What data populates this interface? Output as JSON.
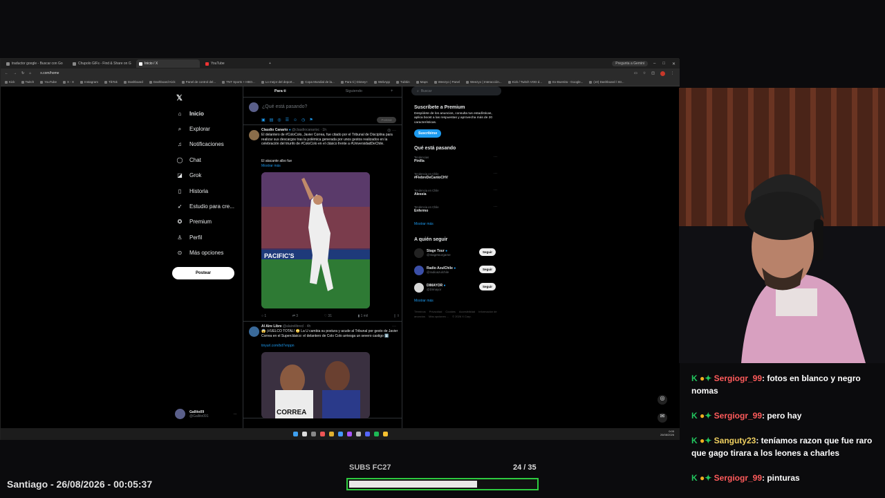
{
  "browser": {
    "tabs": [
      {
        "label": "traductor google - Buscar con Go",
        "active": false
      },
      {
        "label": "Chupolo GIFs - Find & Share on G",
        "active": false
      },
      {
        "label": "Inicio / X",
        "active": true
      },
      {
        "label": "YouTube",
        "active": false
      }
    ],
    "gemini_label": "Pregunta a Gemini",
    "url": "x.com/home",
    "bookmarks": [
      "Kick",
      "Twitch",
      "YouTube",
      "X - X",
      "Instagram",
      "TikTok",
      "Dashboard",
      "Dashboard Kick",
      "Panel de control del...",
      "TNT Sports + HBO...",
      "Lo mejor del deport...",
      "Copa Mundial de la...",
      "Para ti | Disney+",
      "WebApp",
      "Tubbin",
      "Maps",
      "Weezyo | Panel",
      "Weezyo | Interacción...",
      "Kick / Twitch VOD d...",
      "Ex-Buenita - Google...",
      "(10) Dashboard / Str..."
    ]
  },
  "x": {
    "nav": [
      {
        "icon": "home-icon",
        "glyph": "⌂",
        "label": "Inicio",
        "bold": true
      },
      {
        "icon": "search-icon",
        "glyph": "⌕",
        "label": "Explorar"
      },
      {
        "icon": "bell-icon",
        "glyph": "♫",
        "label": "Notificaciones"
      },
      {
        "icon": "chat-icon",
        "glyph": "◯",
        "label": "Chat"
      },
      {
        "icon": "grok-icon",
        "glyph": "◪",
        "label": "Grok"
      },
      {
        "icon": "bookmark-icon",
        "glyph": "▯",
        "label": "Historia"
      },
      {
        "icon": "rocket-icon",
        "glyph": "➶",
        "label": "Estudio para cre..."
      },
      {
        "icon": "premium-icon",
        "glyph": "✪",
        "label": "Premium"
      },
      {
        "icon": "person-icon",
        "glyph": "♙",
        "label": "Perfil"
      },
      {
        "icon": "more-icon",
        "glyph": "⊙",
        "label": "Más opciones"
      }
    ],
    "post_button": "Postear",
    "user": {
      "name": "Gallito09",
      "handle": "@Gallito091"
    },
    "feed_tabs": [
      "Para ti",
      "Siguiendo"
    ],
    "compose_placeholder": "¿Qué está pasando?",
    "compose_post": "Postear",
    "tweets": [
      {
        "author": "Claudio Canario",
        "handle": "@claudiocanarioc · 1h",
        "text": "El delantero de #ColoColo, Javier Correa, fue citado por el Tribunal de Disciplina para realizar sus descargos tras la polémica generada por unos gestos realizados en la celebración del triunfo de #ColoColo en el clásico frente a #UniversidadDeChile.",
        "text2": "El atacante albo fue",
        "more": "Mostrar más",
        "stats": [
          "1",
          "3",
          "31",
          "1 mil"
        ]
      },
      {
        "author": "Al Aire Libre",
        "handle": "@alairelibrecl · 4h",
        "text": "😱 ¡VUELCO TOTAL! 😳 La U cambia su postura y acude al Tribunal por gesto de Javier Correa en el Superclásico: el delantero de Colo Colo arriesga un severo castigo ⬇️",
        "link": "tinyurl.com/bd7vnppn"
      }
    ],
    "search_placeholder": "Buscar",
    "premium": {
      "title": "Suscríbete a Premium",
      "body": "Despídete de los anuncios, consulta tus estadísticas, aplica boost a las respuestas y aprovecha más de 20 características.",
      "button": "Suscribirse"
    },
    "trends_title": "Qué está pasando",
    "trends": [
      {
        "label": "Tendencias",
        "name": "Pinilla"
      },
      {
        "label": "Tendencia en Chile",
        "name": "#FiebreDeCantoCHV"
      },
      {
        "label": "Tendencia en Chile",
        "name": "Alessia"
      },
      {
        "label": "Tendencia en Chile",
        "name": "Enfermo"
      }
    ],
    "show_more": "Mostrar más",
    "follow_title": "A quién seguir",
    "follow": [
      {
        "name": "Stage Tour",
        "handle": "@stagetourgame",
        "color": "#222222"
      },
      {
        "name": "Radio AzulChile",
        "handle": "@radioazulchile",
        "color": "#3b4fa8"
      },
      {
        "name": "DIMAYOR",
        "handle": "@Dimayor",
        "color": "#d8d8d8"
      }
    ],
    "follow_button": "Seguir",
    "footer": [
      "Términos",
      "Privacidad",
      "Cookies",
      "Accesibilidad",
      "Información de anuncios",
      "Más opciones ...",
      "© 2026 X Corp."
    ]
  },
  "clock": {
    "time": "0:05",
    "date": "26/08/2026"
  },
  "chat": [
    {
      "nick": "Sergiogr_99",
      "text": ": fotos en blanco y negro nomas",
      "nick_color": "red"
    },
    {
      "nick": "Sergiogr_99",
      "text": ": pero hay",
      "nick_color": "red"
    },
    {
      "nick": "Sanguty23",
      "text": ": teníamos razon que fue raro que gago tirara a los leones a charles",
      "nick_color": "yellow"
    },
    {
      "nick": "Sergiogr_99",
      "text": ": pinturas",
      "nick_color": "red"
    }
  ],
  "location_time": "Santiago - 26/08/2026 - 00:05:37",
  "subs": {
    "label": "SUBS FC27",
    "count": "24 / 35",
    "progress": 0.686
  },
  "colors": {
    "x_blue": "#1d9bf0",
    "progress_border": "#2ecc40",
    "chat_nick": "#ff5b5b"
  }
}
